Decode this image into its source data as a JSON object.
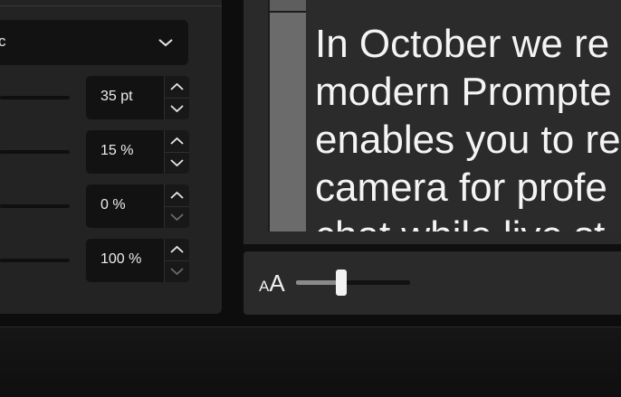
{
  "style_panel": {
    "dropdown_value": "c",
    "rows": [
      {
        "value": "35 pt",
        "up_enabled": true,
        "down_enabled": true
      },
      {
        "value": "15 %",
        "up_enabled": true,
        "down_enabled": true
      },
      {
        "value": "0 %",
        "up_enabled": true,
        "down_enabled": false
      },
      {
        "value": "100 %",
        "up_enabled": true,
        "down_enabled": false
      }
    ]
  },
  "prompter": {
    "text": "In October we re\nmodern Prompte\nenables you to re\ncamera for profe\nchat while live st"
  },
  "font_size_control": {
    "icon": "text-size-icon",
    "icon_text_small": "A",
    "icon_text_large": "A",
    "level_percent": 40
  },
  "colors": {
    "panel_bg": "#232323",
    "field_bg": "#121212",
    "text": "#f4f4f4",
    "app_bg": "#0d0d0e"
  }
}
